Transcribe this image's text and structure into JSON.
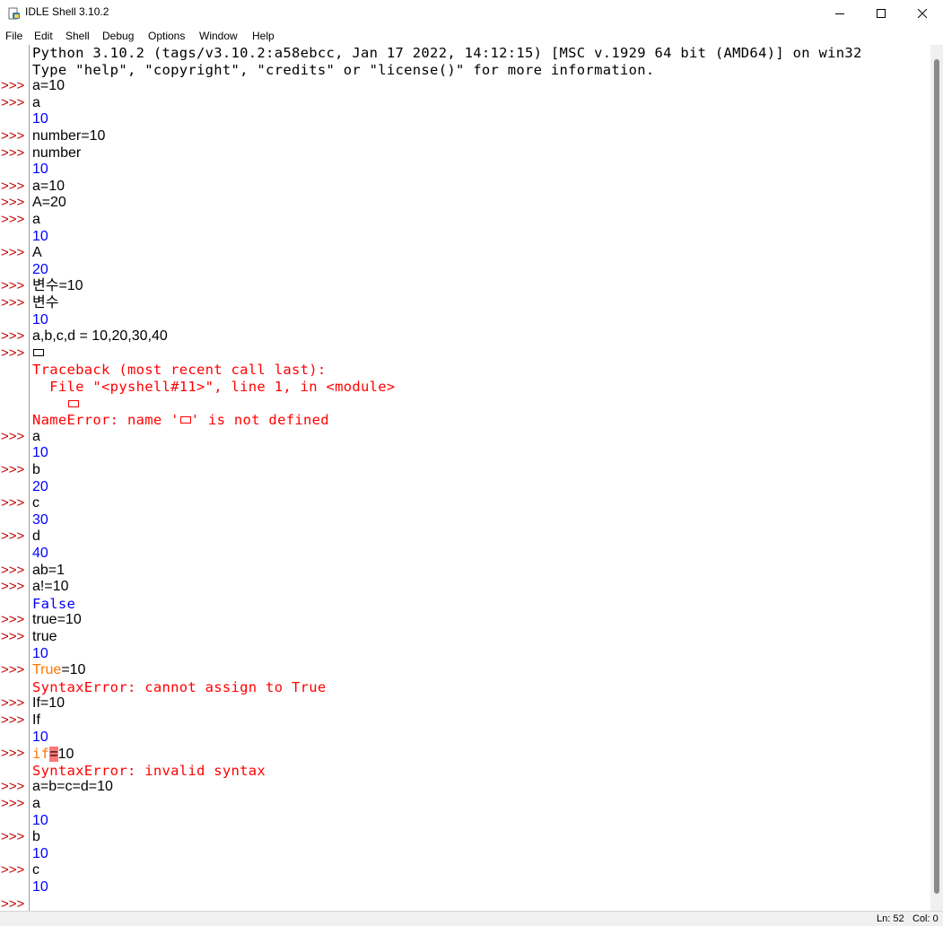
{
  "window": {
    "title": "IDLE Shell 3.10.2",
    "icon": "python-idle-icon"
  },
  "menu": [
    "File",
    "Edit",
    "Shell",
    "Debug",
    "Options",
    "Window",
    "Help"
  ],
  "colors": {
    "prompt": "#c00000",
    "output": "#0000ff",
    "error": "#ff0000",
    "keyword": "#ff7700",
    "error_highlight": "#ff7777"
  },
  "shell": {
    "banner": [
      "Python 3.10.2 (tags/v3.10.2:a58ebcc, Jan 17 2022, 14:12:15) [MSC v.1929 64 bit (AMD64)] on win32",
      "Type \"help\", \"copyright\", \"credits\" or \"license()\" for more information."
    ],
    "prompt": ">>>",
    "lines": [
      {
        "prompt": true,
        "kind": "input",
        "text": "a=10"
      },
      {
        "prompt": true,
        "kind": "input",
        "text": "a"
      },
      {
        "prompt": false,
        "kind": "output",
        "text": "10"
      },
      {
        "prompt": true,
        "kind": "input",
        "text": "number=10"
      },
      {
        "prompt": true,
        "kind": "input",
        "text": "number"
      },
      {
        "prompt": false,
        "kind": "output",
        "text": "10"
      },
      {
        "prompt": true,
        "kind": "input",
        "text": "a=10"
      },
      {
        "prompt": true,
        "kind": "input",
        "text": "A=20"
      },
      {
        "prompt": true,
        "kind": "input",
        "text": "a"
      },
      {
        "prompt": false,
        "kind": "output",
        "text": "10"
      },
      {
        "prompt": true,
        "kind": "input",
        "text": "A"
      },
      {
        "prompt": false,
        "kind": "output",
        "text": "20"
      },
      {
        "prompt": true,
        "kind": "input",
        "text": "변수=10"
      },
      {
        "prompt": true,
        "kind": "input",
        "text": "변수"
      },
      {
        "prompt": false,
        "kind": "output",
        "text": "10"
      },
      {
        "prompt": true,
        "kind": "input",
        "text": "a,b,c,d = 10,20,30,40"
      },
      {
        "prompt": true,
        "kind": "input_box",
        "text": ""
      },
      {
        "prompt": false,
        "kind": "error",
        "text": "Traceback (most recent call last):"
      },
      {
        "prompt": false,
        "kind": "error",
        "text": "  File \"<pyshell#11>\", line 1, in <module>"
      },
      {
        "prompt": false,
        "kind": "error_box",
        "text": "    "
      },
      {
        "prompt": false,
        "kind": "error_name",
        "text_before": "NameError: name '",
        "text_after": "' is not defined"
      },
      {
        "prompt": true,
        "kind": "input",
        "text": "a"
      },
      {
        "prompt": false,
        "kind": "output",
        "text": "10"
      },
      {
        "prompt": true,
        "kind": "input",
        "text": "b"
      },
      {
        "prompt": false,
        "kind": "output",
        "text": "20"
      },
      {
        "prompt": true,
        "kind": "input",
        "text": "c"
      },
      {
        "prompt": false,
        "kind": "output",
        "text": "30"
      },
      {
        "prompt": true,
        "kind": "input",
        "text": "d"
      },
      {
        "prompt": false,
        "kind": "output",
        "text": "40"
      },
      {
        "prompt": true,
        "kind": "input",
        "text": "ab=1"
      },
      {
        "prompt": true,
        "kind": "input",
        "text": "a!=10"
      },
      {
        "prompt": false,
        "kind": "output_mono",
        "text": "False"
      },
      {
        "prompt": true,
        "kind": "input",
        "text": "true=10"
      },
      {
        "prompt": true,
        "kind": "input",
        "text": "true"
      },
      {
        "prompt": false,
        "kind": "output",
        "text": "10"
      },
      {
        "prompt": true,
        "kind": "input_kw",
        "kw": "True",
        "rest": "=10"
      },
      {
        "prompt": false,
        "kind": "error",
        "text": "SyntaxError: cannot assign to True"
      },
      {
        "prompt": true,
        "kind": "input",
        "text": "If=10"
      },
      {
        "prompt": true,
        "kind": "input",
        "text": "If"
      },
      {
        "prompt": false,
        "kind": "output",
        "text": "10"
      },
      {
        "prompt": true,
        "kind": "input_kw_err",
        "kw": "if",
        "hl": "=",
        "rest": "10"
      },
      {
        "prompt": false,
        "kind": "error",
        "text": "SyntaxError: invalid syntax"
      },
      {
        "prompt": true,
        "kind": "input",
        "text": "a=b=c=d=10"
      },
      {
        "prompt": true,
        "kind": "input",
        "text": "a"
      },
      {
        "prompt": false,
        "kind": "output",
        "text": "10"
      },
      {
        "prompt": true,
        "kind": "input",
        "text": "b"
      },
      {
        "prompt": false,
        "kind": "output",
        "text": "10"
      },
      {
        "prompt": true,
        "kind": "input",
        "text": "c"
      },
      {
        "prompt": false,
        "kind": "output",
        "text": "10"
      },
      {
        "prompt": true,
        "kind": "empty",
        "text": ""
      }
    ]
  },
  "status": {
    "line": "Ln: 52",
    "col": "Col: 0"
  }
}
